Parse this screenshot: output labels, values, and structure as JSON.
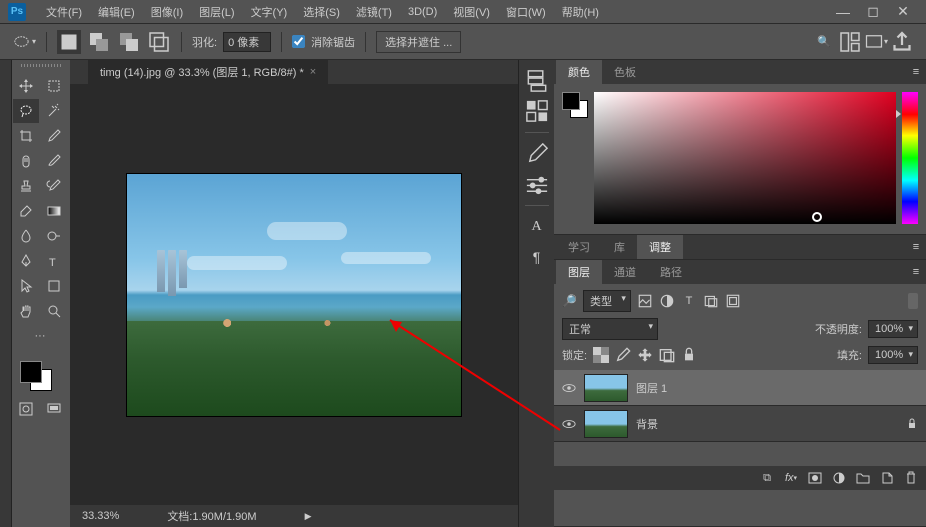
{
  "menu": {
    "file": "文件(F)",
    "edit": "编辑(E)",
    "image": "图像(I)",
    "layer": "图层(L)",
    "type": "文字(Y)",
    "select": "选择(S)",
    "filter": "滤镜(T)",
    "threed": "3D(D)",
    "view": "视图(V)",
    "window": "窗口(W)",
    "help": "帮助(H)"
  },
  "options": {
    "feather_label": "羽化:",
    "feather_value": "0 像素",
    "aa": "消除锯齿",
    "refine": "选择并遮住 ..."
  },
  "doc": {
    "tab": "timg (14).jpg @ 33.3% (图层 1, RGB/8#) *"
  },
  "status": {
    "zoom": "33.33%",
    "docsize": "文档:1.90M/1.90M"
  },
  "panels": {
    "color": {
      "tab1": "颜色",
      "tab2": "色板"
    },
    "adjust": {
      "tab1": "学习",
      "tab2": "库",
      "tab3": "调整"
    },
    "layers": {
      "tab1": "图层",
      "tab2": "通道",
      "tab3": "路径",
      "kind": "类型",
      "blend": "正常",
      "opacity_label": "不透明度:",
      "opacity": "100%",
      "lock_label": "锁定:",
      "fill_label": "填充:",
      "fill": "100%",
      "layer1": "图层 1",
      "bg": "背景"
    }
  }
}
